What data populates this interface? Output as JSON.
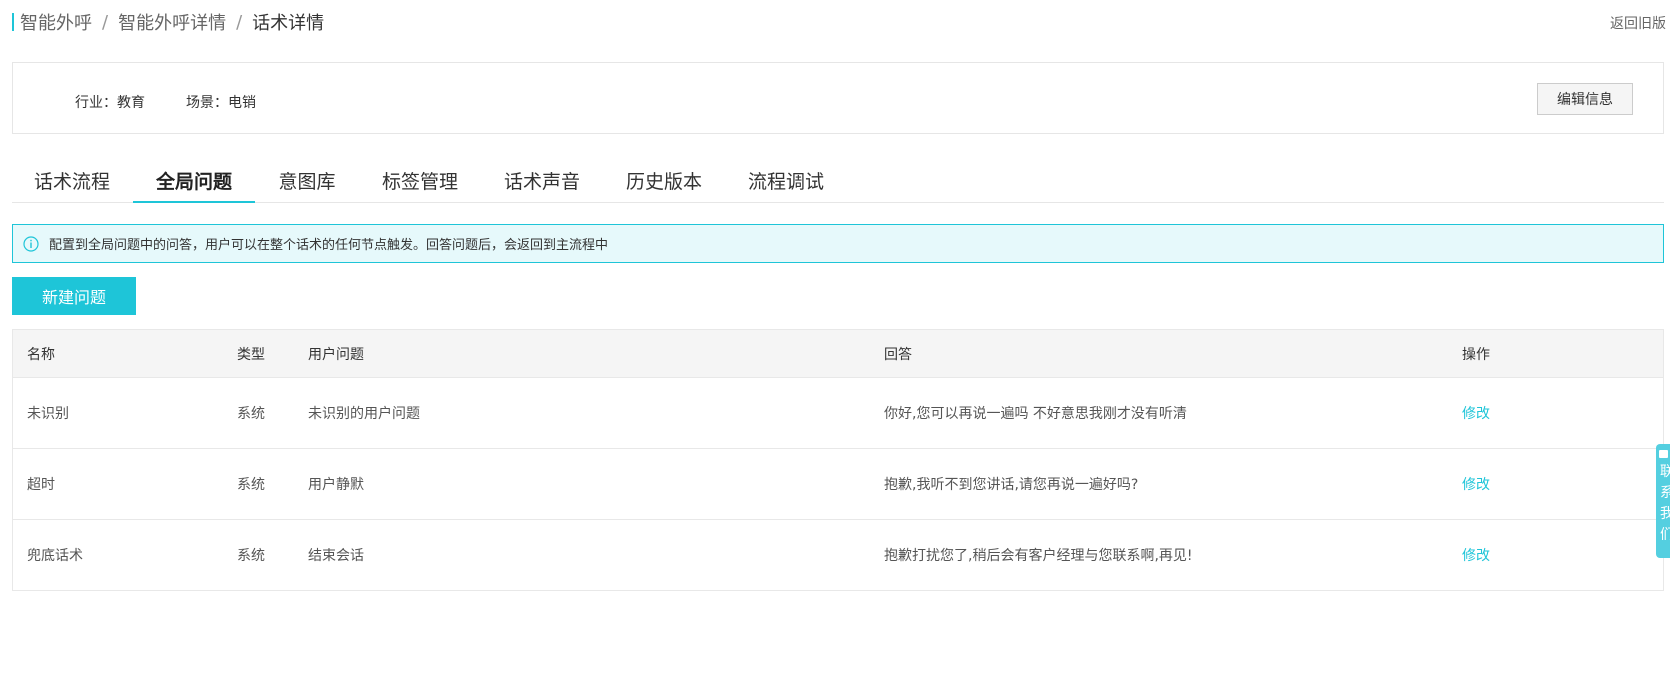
{
  "breadcrumb": [
    "智能外呼",
    "智能外呼详情",
    "话术详情"
  ],
  "back_old_label": "返回旧版",
  "info": {
    "industry": "行业：教育",
    "scene": "场景：电销",
    "edit_label": "编辑信息"
  },
  "tabs": [
    {
      "label": "话术流程",
      "active": false
    },
    {
      "label": "全局问题",
      "active": true
    },
    {
      "label": "意图库",
      "active": false
    },
    {
      "label": "标签管理",
      "active": false
    },
    {
      "label": "话术声音",
      "active": false
    },
    {
      "label": "历史版本",
      "active": false
    },
    {
      "label": "流程调试",
      "active": false
    }
  ],
  "notice": {
    "icon": "info-icon",
    "text": "配置到全局问题中的问答，用户可以在整个话术的任何节点触发。回答问题后，会返回到主流程中"
  },
  "new_button_label": "新建问题",
  "table": {
    "columns": [
      "名称",
      "类型",
      "用户问题",
      "回答",
      "操作"
    ],
    "rows": [
      {
        "name": "未识别",
        "type": "系统",
        "question": "未识别的用户问题",
        "answer": "你好,您可以再说一遍吗 不好意思我刚才没有听清",
        "action": "修改"
      },
      {
        "name": "超时",
        "type": "系统",
        "question": "用户静默",
        "answer": "抱歉,我听不到您讲话,请您再说一遍好吗?",
        "action": "修改"
      },
      {
        "name": "兜底话术",
        "type": "系统",
        "question": "结束会话",
        "answer": "抱歉打扰您了,稍后会有客户经理与您联系啊,再见!",
        "action": "修改"
      }
    ]
  },
  "float_side": {
    "text": "联系我们"
  },
  "colors": {
    "accent": "#1ec5d8",
    "notice_bg": "#e6f9fb"
  }
}
